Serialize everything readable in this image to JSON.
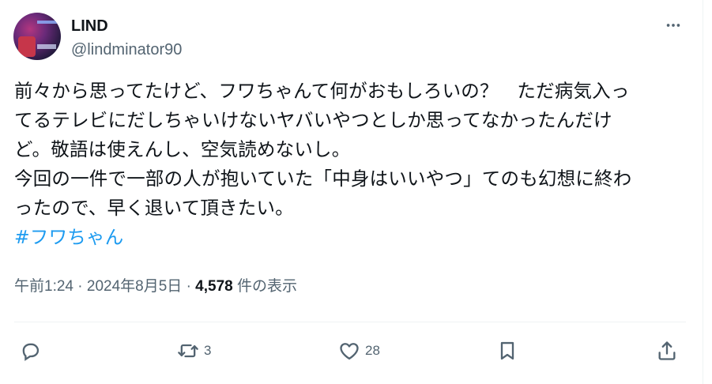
{
  "user": {
    "display_name": "LIND",
    "handle": "@lindminator90"
  },
  "tweet": {
    "text_lines": [
      "前々から思ってたけど、フワちゃんて何がおもしろいの？　ただ病気入っ",
      "てるテレビにだしちゃいけないヤバいやつとしか思ってなかったんだけ",
      "ど。敬語は使えんし、空気読めないし。",
      "今回の一件で一部の人が抱いていた「中身はいいやつ」てのも幻想に終わ",
      "ったので、早く退いて頂きたい。"
    ],
    "hashtag": "#フワちゃん"
  },
  "meta": {
    "time": "午前1:24",
    "date": "2024年8月5日",
    "views_count": "4,578",
    "views_label": "件の表示"
  },
  "actions": {
    "reply_count": "",
    "retweet_count": "3",
    "like_count": "28"
  },
  "icons": {
    "avatar": "avatar-image",
    "more": "more-icon",
    "reply": "reply-icon",
    "retweet": "retweet-icon",
    "like": "heart-icon",
    "bookmark": "bookmark-icon",
    "share": "share-icon"
  },
  "colors": {
    "text": "#0f1419",
    "secondary": "#536471",
    "link": "#1d9bf0",
    "divider": "#eff3f4"
  }
}
